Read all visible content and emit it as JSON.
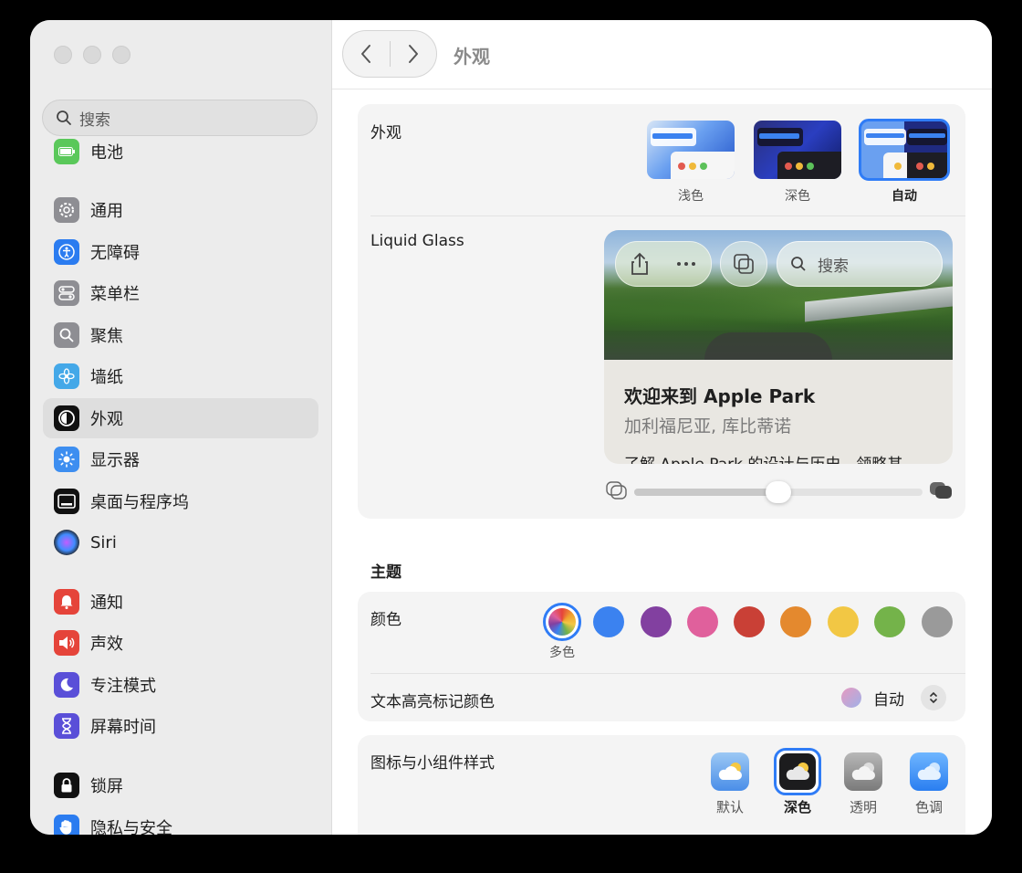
{
  "sidebar": {
    "search_placeholder": "搜索",
    "items": [
      {
        "label": "电池",
        "icon": "battery-icon",
        "color": "#5ac85a"
      },
      {
        "label": "通用",
        "icon": "gear-icon",
        "color": "#8e8e93"
      },
      {
        "label": "无障碍",
        "icon": "accessibility-icon",
        "color": "#2b7cf0"
      },
      {
        "label": "菜单栏",
        "icon": "menubar-icon",
        "color": "#8e8e93"
      },
      {
        "label": "聚焦",
        "icon": "spotlight-icon",
        "color": "#8e8e93"
      },
      {
        "label": "墙纸",
        "icon": "wallpaper-icon",
        "color": "#44a8e8"
      },
      {
        "label": "外观",
        "icon": "appearance-icon",
        "color": "#111111",
        "active": true
      },
      {
        "label": "显示器",
        "icon": "display-icon",
        "color": "#3d8ef0"
      },
      {
        "label": "桌面与程序坞",
        "icon": "dock-icon",
        "color": "#111111"
      },
      {
        "label": "Siri",
        "icon": "siri-icon",
        "color": "#222222"
      },
      {
        "label": "通知",
        "icon": "notification-icon",
        "color": "#e5443a"
      },
      {
        "label": "声效",
        "icon": "sound-icon",
        "color": "#e5443a"
      },
      {
        "label": "专注模式",
        "icon": "focus-icon",
        "color": "#5a4fd8"
      },
      {
        "label": "屏幕时间",
        "icon": "screentime-icon",
        "color": "#5a4fd8"
      },
      {
        "label": "锁屏",
        "icon": "lock-icon",
        "color": "#111111"
      },
      {
        "label": "隐私与安全",
        "icon": "privacy-icon",
        "color": "#2b7cf0"
      }
    ]
  },
  "toolbar": {
    "title": "外观"
  },
  "appearance": {
    "label": "外观",
    "options": [
      {
        "label": "浅色",
        "selected": false
      },
      {
        "label": "深色",
        "selected": false
      },
      {
        "label": "自动",
        "selected": true
      }
    ]
  },
  "liquid_glass": {
    "label": "Liquid Glass",
    "search_label": "搜索",
    "card_title": "欢迎来到 Apple Park",
    "card_subtitle": "加利福尼亚, 库比蒂诺",
    "card_body": "了解 Apple Park 的设计与历史，领略其",
    "slider_value": 0.5
  },
  "theme": {
    "section_title": "主题",
    "color_label": "颜色",
    "colors": [
      {
        "name": "多色",
        "color": "multicolor",
        "selected": true
      },
      {
        "color": "#3b82f0"
      },
      {
        "color": "#8240a0"
      },
      {
        "color": "#e0609c"
      },
      {
        "color": "#c94036"
      },
      {
        "color": "#e4892e"
      },
      {
        "color": "#f2c744"
      },
      {
        "color": "#74b34a"
      },
      {
        "color": "#9a9a9a"
      }
    ],
    "highlight_label": "文本高亮标记颜色",
    "highlight_value": "自动"
  },
  "icon_style": {
    "label": "图标与小组件样式",
    "options": [
      {
        "label": "默认",
        "selected": false
      },
      {
        "label": "深色",
        "selected": true
      },
      {
        "label": "透明",
        "selected": false
      },
      {
        "label": "色调",
        "selected": false
      }
    ]
  }
}
